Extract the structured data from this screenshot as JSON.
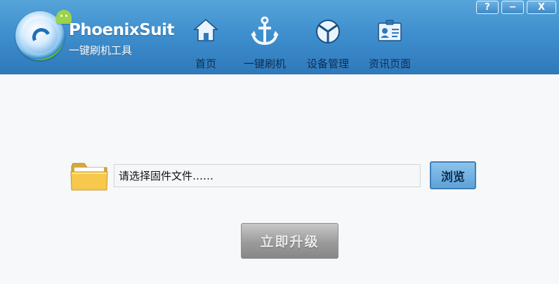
{
  "app": {
    "brand_name": "PhoenixSuit",
    "brand_subtitle": "一键刷机工具"
  },
  "nav": {
    "items": [
      {
        "label": "首页",
        "icon": "home-icon"
      },
      {
        "label": "一键刷机",
        "icon": "anchor-icon"
      },
      {
        "label": "设备管理",
        "icon": "device-icon"
      },
      {
        "label": "资讯页面",
        "icon": "badge-icon"
      }
    ],
    "active_index": 1
  },
  "window_controls": {
    "help": "?",
    "minimize": "−",
    "close": "X"
  },
  "firmware": {
    "placeholder": "请选择固件文件……",
    "browse_label": "浏览",
    "upgrade_label": "立即升级"
  },
  "colors": {
    "header_top": "#55a4d9",
    "header_bottom": "#2f79bb",
    "body_bg": "#f7f8fa",
    "nav_text": "#0d2d52"
  }
}
